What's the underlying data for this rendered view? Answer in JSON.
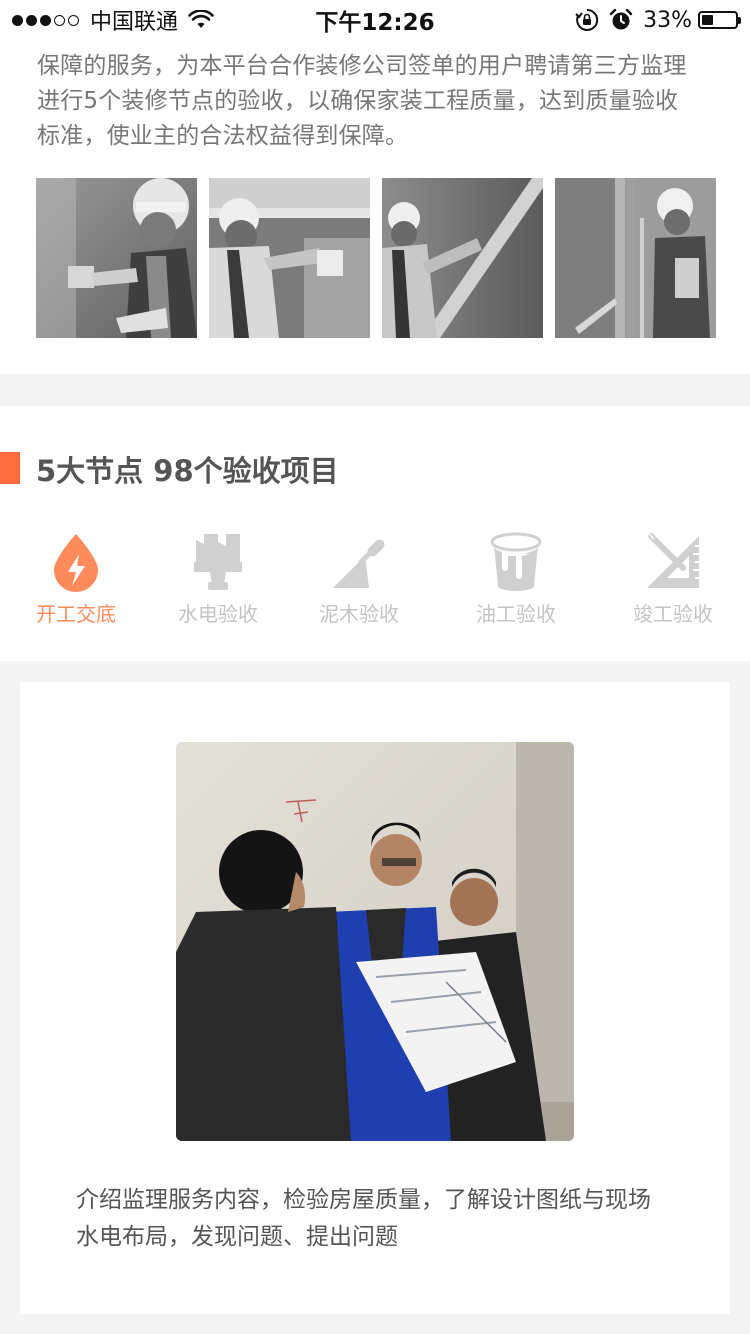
{
  "status_bar": {
    "carrier": "中国联通",
    "time": "下午12:26",
    "battery_percent": "33%",
    "battery_level": 0.33,
    "signal_bars_filled": 3,
    "signal_bars_total": 5,
    "icons": [
      "wifi-icon",
      "rotation-lock-icon",
      "alarm-icon",
      "battery-icon"
    ]
  },
  "intro": {
    "lines": [
      "保障的服务，为本平台合作装修公司签单的用户聘请第三方监理",
      "进行5个装修节点的验收，以确保家装工程质量，达到质量验收",
      "标准，使业主的合法权益得到保障。"
    ]
  },
  "nodes_section": {
    "title": "5大节点 98个验收项目",
    "accent_color": "#ff6b3d",
    "tabs": [
      {
        "label": "开工交底",
        "icon": "water-drop-lightning-icon",
        "active": true
      },
      {
        "label": "水电验收",
        "icon": "paint-brush-icon",
        "active": false
      },
      {
        "label": "泥木验收",
        "icon": "trowel-icon",
        "active": false
      },
      {
        "label": "油工验收",
        "icon": "paint-bucket-icon",
        "active": false
      },
      {
        "label": "竣工验收",
        "icon": "ruler-pencil-icon",
        "active": false
      }
    ],
    "active_color": "#ff8a5c",
    "inactive_color": "#c4c4c4"
  },
  "card": {
    "caption_lines": [
      "介绍监理服务内容，检验房屋质量，了解设计图纸与现场",
      "水电布局，发现问题、提出问题"
    ]
  }
}
